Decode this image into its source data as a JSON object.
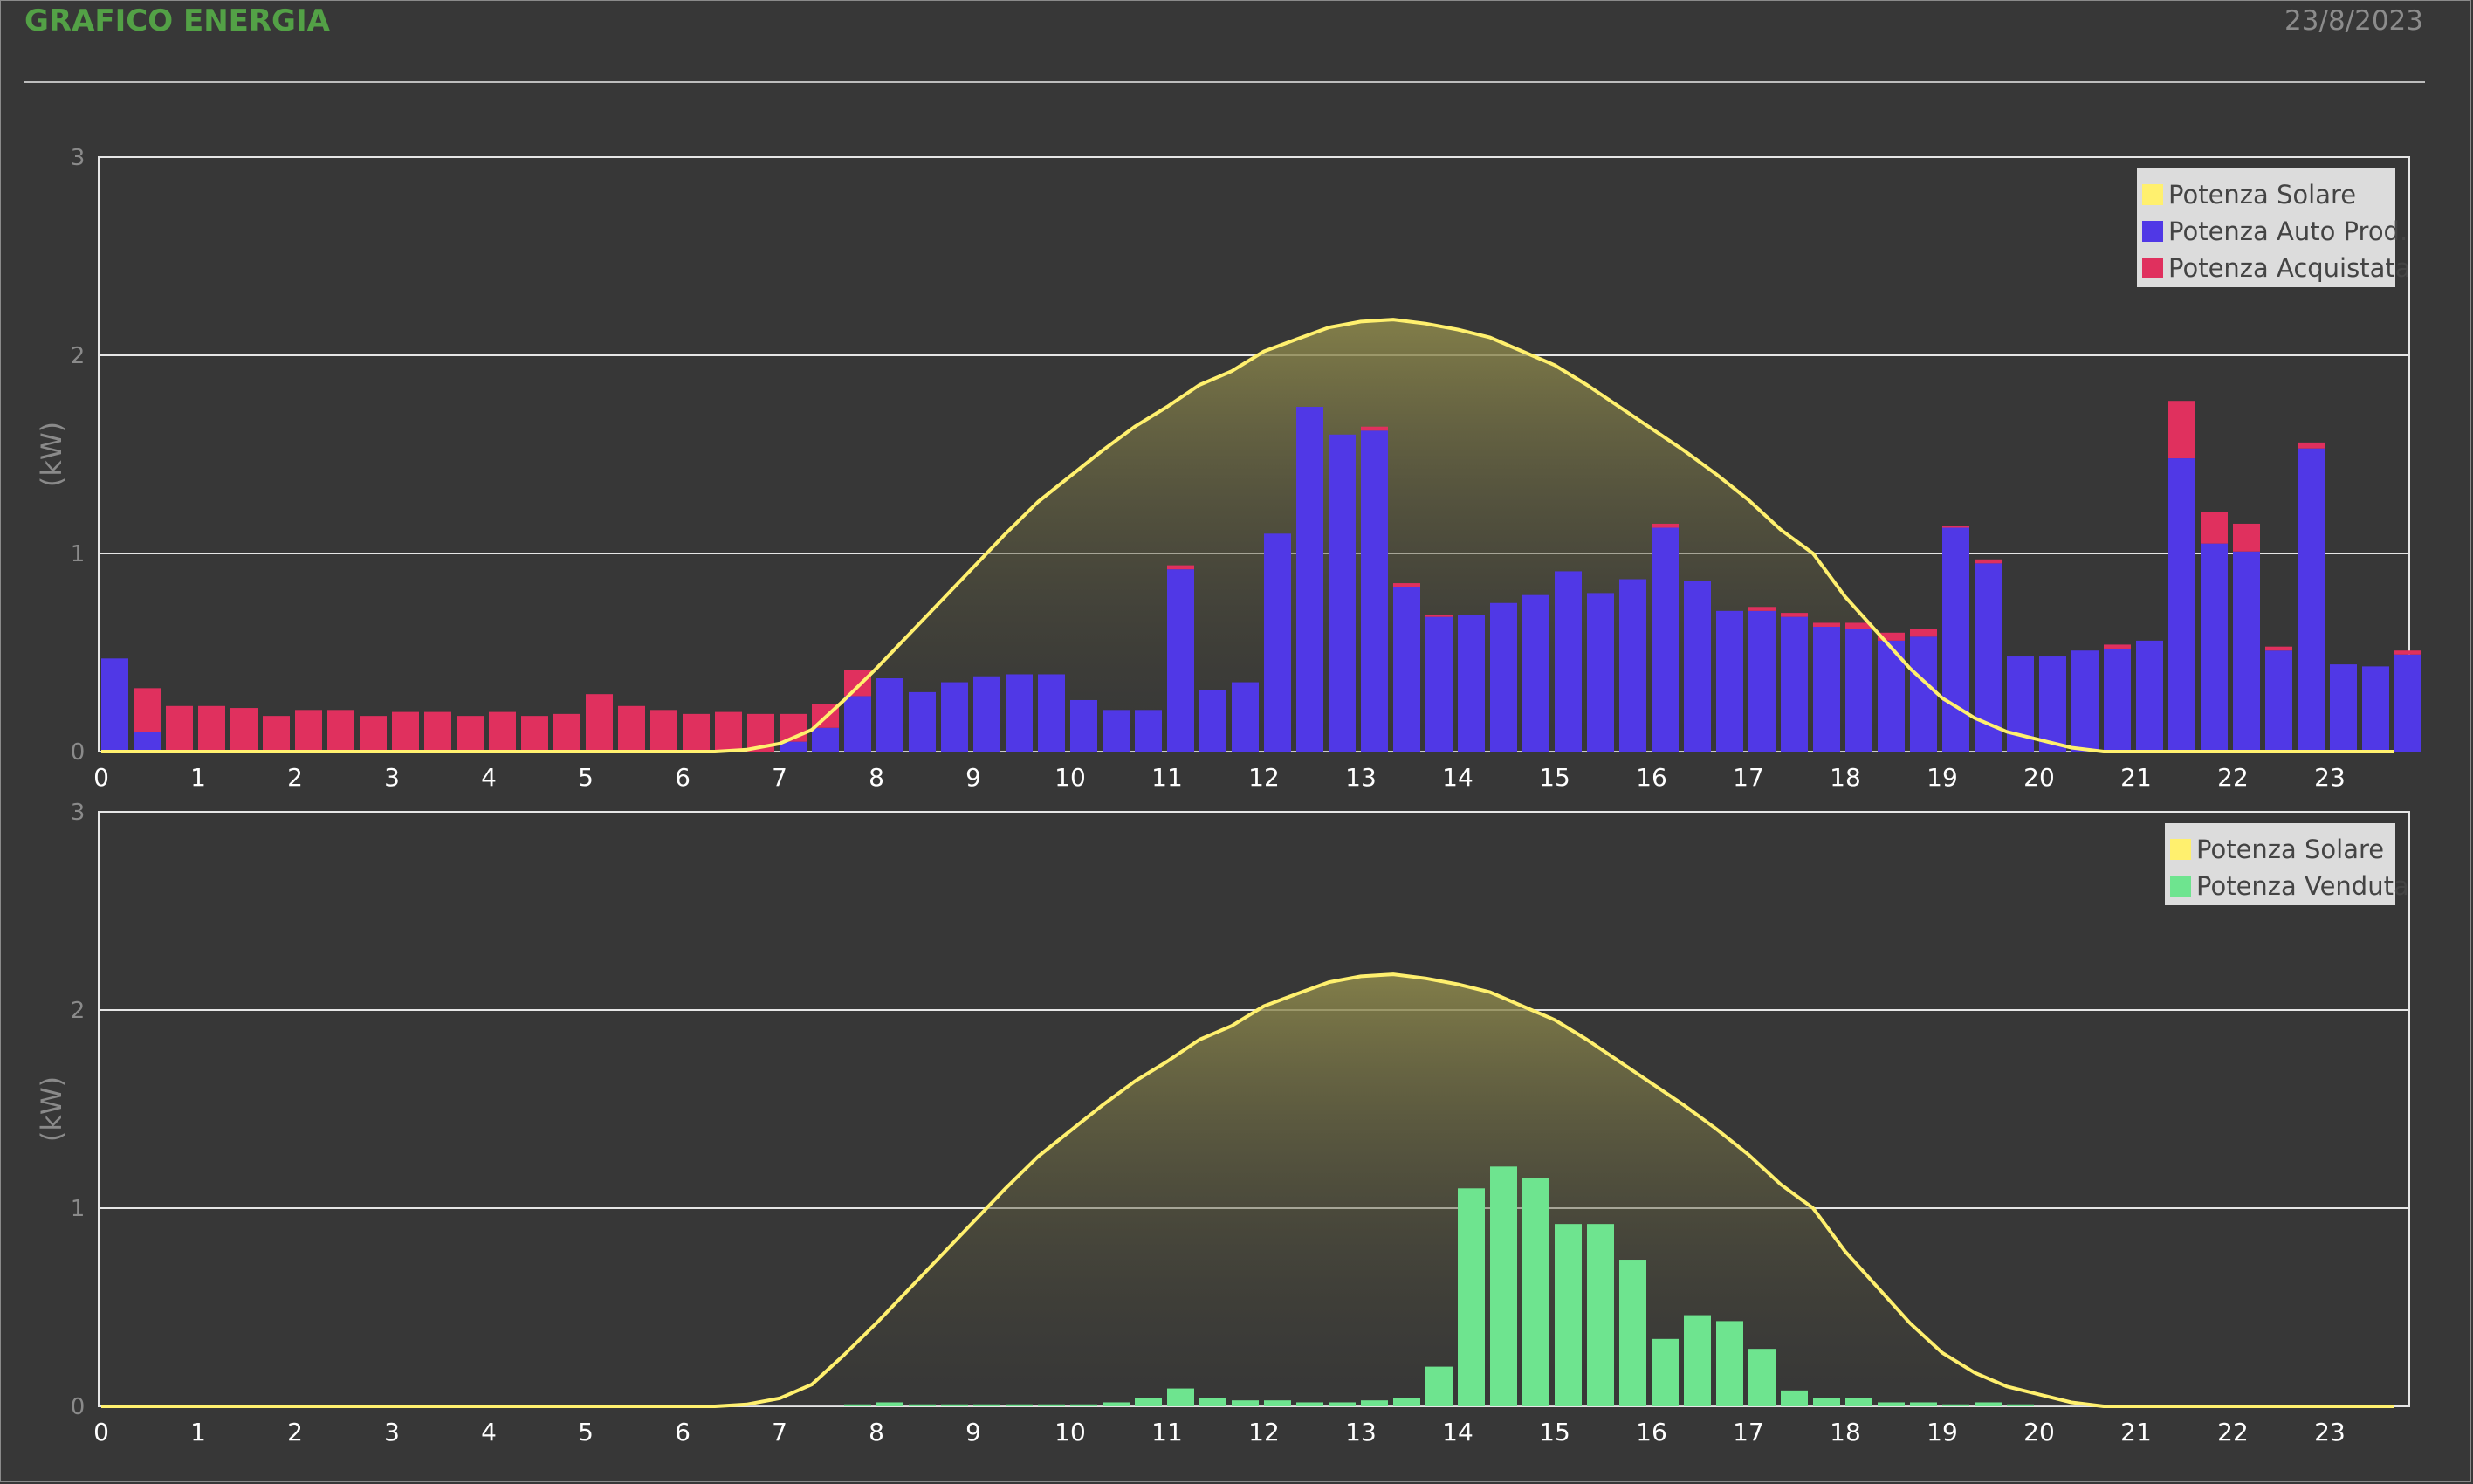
{
  "header": {
    "title": "GRAFICO ENERGIA",
    "date": "23/8/2023"
  },
  "colors": {
    "background": "#373737",
    "title": "#53a146",
    "solar_line": "#fff06e",
    "solar_fill_top": "#8f8a4c",
    "auto_prod": "#5038e6",
    "acquistata": "#e0305e",
    "venduta": "#6ee48f",
    "grid": "#e6e6e6",
    "legend_bg": "#dcdcdc"
  },
  "chart_data": [
    {
      "type": "bar",
      "ylabel": "(kW)",
      "ylim": [
        0,
        3
      ],
      "yticks": [
        "0",
        "1",
        "2",
        "3"
      ],
      "xticks": [
        "0",
        "1",
        "2",
        "3",
        "4",
        "5",
        "6",
        "7",
        "8",
        "9",
        "10",
        "11",
        "12",
        "13",
        "14",
        "15",
        "16",
        "17",
        "18",
        "19",
        "20",
        "21",
        "22",
        "23"
      ],
      "x_interval_hours": 0.333,
      "grid": true,
      "legend_position": "top-right",
      "legend": [
        "Potenza Solare",
        "Potenza Auto Prod.",
        "Potenza Acquistata"
      ],
      "series": [
        {
          "name": "Potenza Solare",
          "kind": "area-line",
          "values": [
            0,
            0,
            0,
            0,
            0,
            0,
            0,
            0,
            0,
            0,
            0,
            0,
            0,
            0,
            0,
            0,
            0,
            0,
            0,
            0,
            0.01,
            0.04,
            0.11,
            0.26,
            0.42,
            0.59,
            0.76,
            0.93,
            1.1,
            1.26,
            1.39,
            1.52,
            1.64,
            1.74,
            1.85,
            1.92,
            2.02,
            2.08,
            2.14,
            2.17,
            2.18,
            2.16,
            2.13,
            2.09,
            2.02,
            1.95,
            1.85,
            1.74,
            1.63,
            1.52,
            1.4,
            1.27,
            1.12,
            1.0,
            0.78,
            0.6,
            0.42,
            0.27,
            0.17,
            0.1,
            0.06,
            0.02,
            0,
            0,
            0,
            0,
            0,
            0,
            0,
            0,
            0,
            0
          ]
        },
        {
          "name": "Potenza Auto Prod.",
          "kind": "stacked-bar",
          "values": [
            0.47,
            0.1,
            0,
            0,
            0,
            0,
            0,
            0,
            0,
            0,
            0,
            0,
            0,
            0,
            0,
            0,
            0,
            0,
            0,
            0,
            0,
            0.05,
            0.12,
            0.28,
            0.37,
            0.3,
            0.35,
            0.38,
            0.39,
            0.39,
            0.26,
            0.21,
            0.21,
            0.92,
            0.31,
            0.35,
            1.1,
            1.74,
            1.6,
            1.62,
            0.83,
            0.68,
            0.69,
            0.75,
            0.79,
            0.91,
            0.8,
            0.87,
            1.13,
            0.86,
            0.71,
            0.71,
            0.68,
            0.63,
            0.62,
            0.56,
            0.58,
            1.13,
            0.95,
            0.48,
            0.48,
            0.51,
            0.52,
            0.56,
            1.48,
            1.05,
            1.01,
            0.51,
            1.53,
            0.44,
            0.43,
            0.49
          ]
        },
        {
          "name": "Potenza Acquistata",
          "kind": "stacked-bar",
          "values": [
            0,
            0.22,
            0.23,
            0.23,
            0.22,
            0.18,
            0.21,
            0.21,
            0.18,
            0.2,
            0.2,
            0.18,
            0.2,
            0.18,
            0.19,
            0.29,
            0.23,
            0.21,
            0.19,
            0.2,
            0.19,
            0.14,
            0.12,
            0.13,
            0,
            0,
            0,
            0,
            0,
            0,
            0,
            0,
            0,
            0.02,
            0,
            0,
            0,
            0,
            0,
            0.02,
            0.02,
            0.01,
            0,
            0,
            0,
            0,
            0,
            0,
            0.02,
            0,
            0,
            0.02,
            0.02,
            0.02,
            0.03,
            0.04,
            0.04,
            0.01,
            0.02,
            0,
            0,
            0,
            0.02,
            0,
            0.29,
            0.16,
            0.14,
            0.02,
            0.03,
            0,
            0,
            0.02
          ]
        }
      ]
    },
    {
      "type": "bar",
      "ylabel": "(kW)",
      "ylim": [
        0,
        3
      ],
      "yticks": [
        "0",
        "1",
        "2",
        "3"
      ],
      "xticks": [
        "0",
        "1",
        "2",
        "3",
        "4",
        "5",
        "6",
        "7",
        "8",
        "9",
        "10",
        "11",
        "12",
        "13",
        "14",
        "15",
        "16",
        "17",
        "18",
        "19",
        "20",
        "21",
        "22",
        "23"
      ],
      "x_interval_hours": 0.333,
      "grid": true,
      "legend_position": "top-right",
      "legend": [
        "Potenza Solare",
        "Potenza Venduta"
      ],
      "series": [
        {
          "name": "Potenza Solare",
          "kind": "area-line",
          "values": [
            0,
            0,
            0,
            0,
            0,
            0,
            0,
            0,
            0,
            0,
            0,
            0,
            0,
            0,
            0,
            0,
            0,
            0,
            0,
            0,
            0.01,
            0.04,
            0.11,
            0.26,
            0.42,
            0.59,
            0.76,
            0.93,
            1.1,
            1.26,
            1.39,
            1.52,
            1.64,
            1.74,
            1.85,
            1.92,
            2.02,
            2.08,
            2.14,
            2.17,
            2.18,
            2.16,
            2.13,
            2.09,
            2.02,
            1.95,
            1.85,
            1.74,
            1.63,
            1.52,
            1.4,
            1.27,
            1.12,
            1.0,
            0.78,
            0.6,
            0.42,
            0.27,
            0.17,
            0.1,
            0.06,
            0.02,
            0,
            0,
            0,
            0,
            0,
            0,
            0,
            0,
            0,
            0
          ]
        },
        {
          "name": "Potenza Venduta",
          "kind": "bar",
          "values": [
            0,
            0,
            0,
            0,
            0,
            0,
            0,
            0,
            0,
            0,
            0,
            0,
            0,
            0,
            0,
            0,
            0,
            0,
            0,
            0,
            0,
            0,
            0,
            0.01,
            0.02,
            0.01,
            0.01,
            0.01,
            0.01,
            0.01,
            0.01,
            0.02,
            0.04,
            0.09,
            0.04,
            0.03,
            0.03,
            0.02,
            0.02,
            0.03,
            0.04,
            0.2,
            1.1,
            1.21,
            1.15,
            0.92,
            0.92,
            0.74,
            0.34,
            0.46,
            0.43,
            0.29,
            0.08,
            0.04,
            0.04,
            0.02,
            0.02,
            0.01,
            0.02,
            0.01,
            0,
            0,
            0,
            0,
            0,
            0,
            0,
            0,
            0,
            0,
            0,
            0
          ]
        }
      ]
    }
  ]
}
